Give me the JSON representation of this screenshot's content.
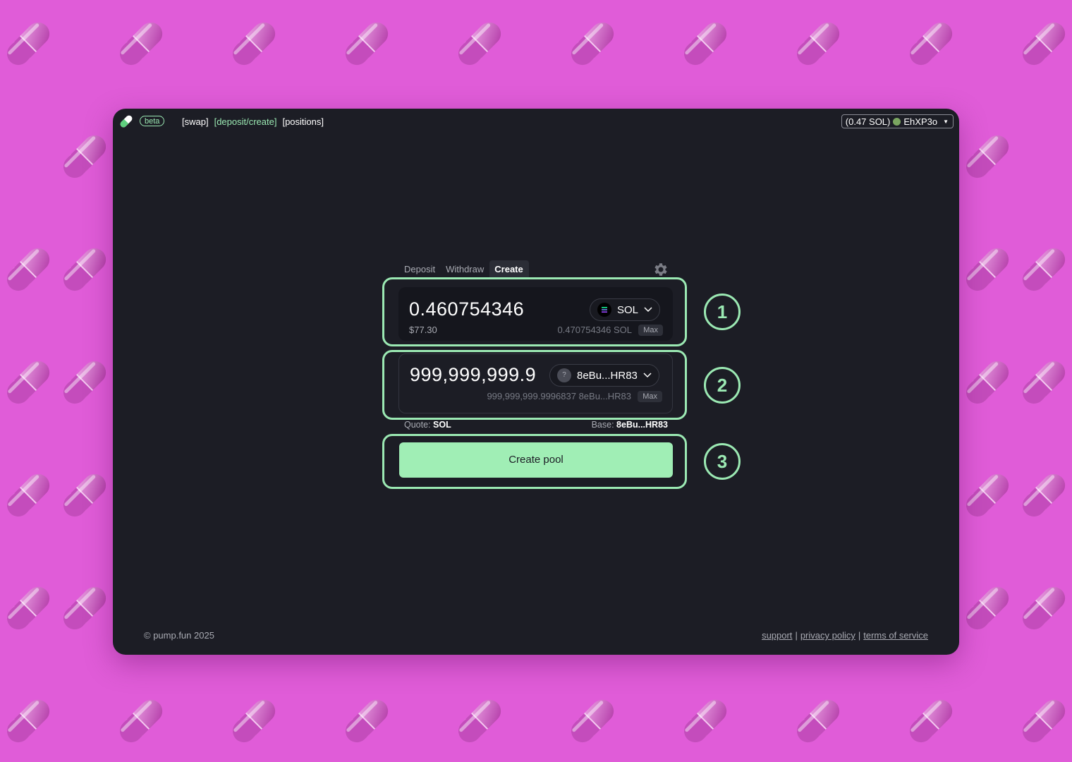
{
  "header": {
    "beta_badge": "beta",
    "nav": [
      "[swap]",
      "[deposit/create]",
      "[positions]"
    ],
    "active_nav_index": 1,
    "wallet": {
      "balance": "(0.47 SOL)",
      "address": "EhXP3o"
    }
  },
  "tabs": [
    {
      "label": "Deposit",
      "selected": false
    },
    {
      "label": "Withdraw",
      "selected": false
    },
    {
      "label": "Create",
      "selected": true
    }
  ],
  "quote_input": {
    "amount": "0.460754346",
    "token": "SOL",
    "usd_value": "$77.30",
    "balance": "0.470754346 SOL",
    "max_label": "Max"
  },
  "base_input": {
    "amount": "999,999,999.9996837",
    "token": "8eBu...HR83",
    "token_icon": "?",
    "balance": "999,999,999.9996837 8eBu...HR83",
    "max_label": "Max"
  },
  "pair": {
    "quote_label": "Quote:",
    "quote_value": "SOL",
    "base_label": "Base:",
    "base_value": "8eBu...HR83"
  },
  "create_button": "Create pool",
  "step_markers": [
    "1",
    "2",
    "3"
  ],
  "footer": {
    "copyright": "© pump.fun 2025",
    "links": [
      "support",
      "privacy policy",
      "terms of service"
    ]
  },
  "colors": {
    "background": "#e05cd8",
    "panel": "#1c1d25",
    "accent": "#9be9b3",
    "button": "#a0eeb5"
  }
}
